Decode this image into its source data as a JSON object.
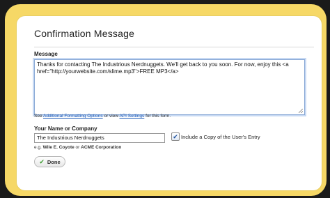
{
  "dialog": {
    "title": "Confirmation Message"
  },
  "message": {
    "label": "Message",
    "value": "Thanks for contacting The Industrious Nerdnuggets. We'll get back to you soon. For now, enjoy this <a href=\"http://yourwebsite.com/slime.mp3\">FREE MP3</a>"
  },
  "help_line": {
    "prefix": "See ",
    "formatting_link": "Additional Formatting Options",
    "middle": " or view ",
    "api_link": "API Settings",
    "suffix": " for this form."
  },
  "name_field": {
    "label": "Your Name or Company",
    "value": "The Industrious Nerdnuggets",
    "example_prefix": "e.g. ",
    "example_1": "Wile E. Coyote",
    "example_or": " or ",
    "example_2": "ACME Corporation"
  },
  "copy_option": {
    "checked": true,
    "label": "Include a Copy of the User's Entry"
  },
  "done_button": {
    "label": "Done"
  },
  "colors": {
    "frame": "#f6d866",
    "link": "#1e5bb8",
    "check": "#3a9b2e"
  }
}
